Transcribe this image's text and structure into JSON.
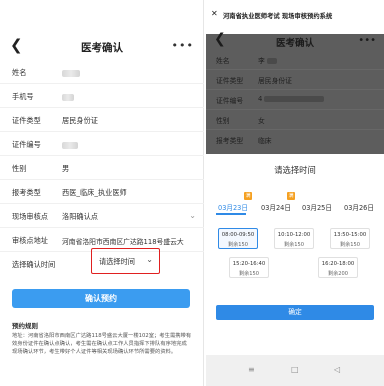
{
  "left": {
    "title": "医考确认",
    "back": "❮",
    "more": "•••",
    "fields": [
      {
        "label": "姓名",
        "value": ""
      },
      {
        "label": "手机号",
        "value": ""
      },
      {
        "label": "证件类型",
        "value": "居民身份证"
      },
      {
        "label": "证件编号",
        "value": ""
      },
      {
        "label": "性别",
        "value": "男"
      },
      {
        "label": "报考类型",
        "value": "西医_临床_执业医师"
      },
      {
        "label": "现场审核点",
        "value": "洛阳确认点"
      },
      {
        "label": "审核点地址",
        "value": "河南省洛阳市西南区广达路118号盛云大"
      }
    ],
    "select_time": {
      "label": "选择确认时间",
      "placeholder": "请选择时间"
    },
    "confirm_button": "确认预约",
    "rules_title": "预约规则",
    "rules_text": "地址：河南省洛阳市西南区广达路118号盛云大厦一楼102室；考生需携带有效身份证件在确认点确认，考生需在确认点工作人员指挥下排队有序地完成现场确认环节，考生带好个人证件等相关现场确认环节所需要的资料。"
  },
  "right": {
    "window_title": "河南省执业医师考试 现场审核预约系统",
    "close": "✕",
    "overlay_title": "医考确认",
    "overlay_fields": [
      {
        "label": "姓名",
        "value": "李"
      },
      {
        "label": "证件类型",
        "value": "居民身份证"
      },
      {
        "label": "证件编号",
        "value": "4"
      },
      {
        "label": "性别",
        "value": "女"
      },
      {
        "label": "报考类型",
        "value": "临床"
      }
    ],
    "sheet_title": "请选择时间",
    "dates": [
      {
        "label": "03月23日",
        "full_badge": "满"
      },
      {
        "label": "03月24日",
        "full_badge": "满"
      },
      {
        "label": "03月25日",
        "full_badge": ""
      },
      {
        "label": "03月26日",
        "full_badge": ""
      }
    ],
    "slots": [
      {
        "time": "08:00-09:50",
        "remain": "剩余150"
      },
      {
        "time": "10:10-12:00",
        "remain": "剩余150"
      },
      {
        "time": "13:50-15:00",
        "remain": "剩余150"
      },
      {
        "time": "15:20-16:40",
        "remain": "剩余150"
      },
      {
        "time": "16:20-18:00",
        "remain": "剩余200"
      }
    ],
    "ok_button": "确定",
    "nav": [
      "≡",
      "□",
      "◁"
    ]
  }
}
